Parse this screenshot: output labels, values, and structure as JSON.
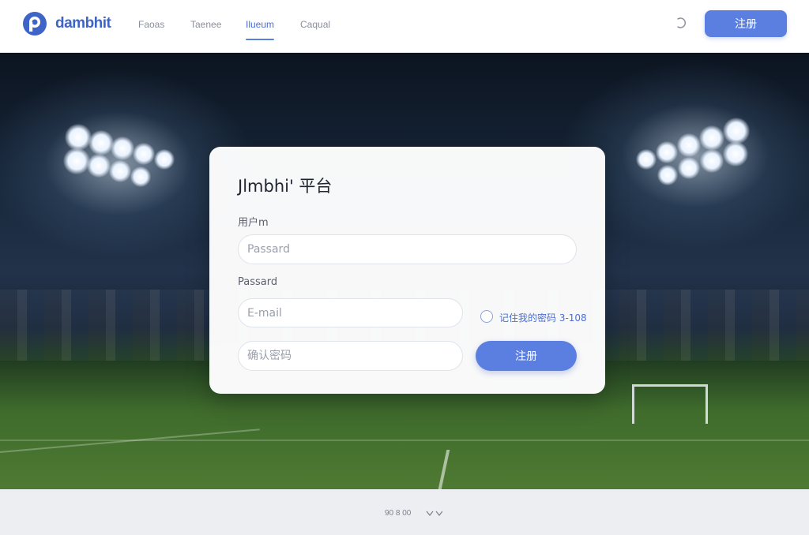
{
  "header": {
    "brand_name": "dambhit",
    "nav": [
      {
        "label": "Faoas"
      },
      {
        "label": "Taenee"
      },
      {
        "label": "Ilueum",
        "active": true
      },
      {
        "label": "Caqual"
      }
    ],
    "theme_icon": "moon-icon",
    "register_button": "注册"
  },
  "form": {
    "title": "Jlmbhi' 平台",
    "username_label": "用户m",
    "username_placeholder": "Passard",
    "password_label": "Passard",
    "email_placeholder": "E-mail",
    "remember_label": "记住我的密码 3-108",
    "confirm_placeholder": "确认密码",
    "submit_label": "注册"
  },
  "footer": {
    "text": "90 8 00",
    "chevron_icon": "chevron-down-icon"
  },
  "colors": {
    "accent": "#5b7fe0",
    "brand": "#3f64c8",
    "card_bg": "#ffffff",
    "footer_bg": "#eceef2"
  }
}
